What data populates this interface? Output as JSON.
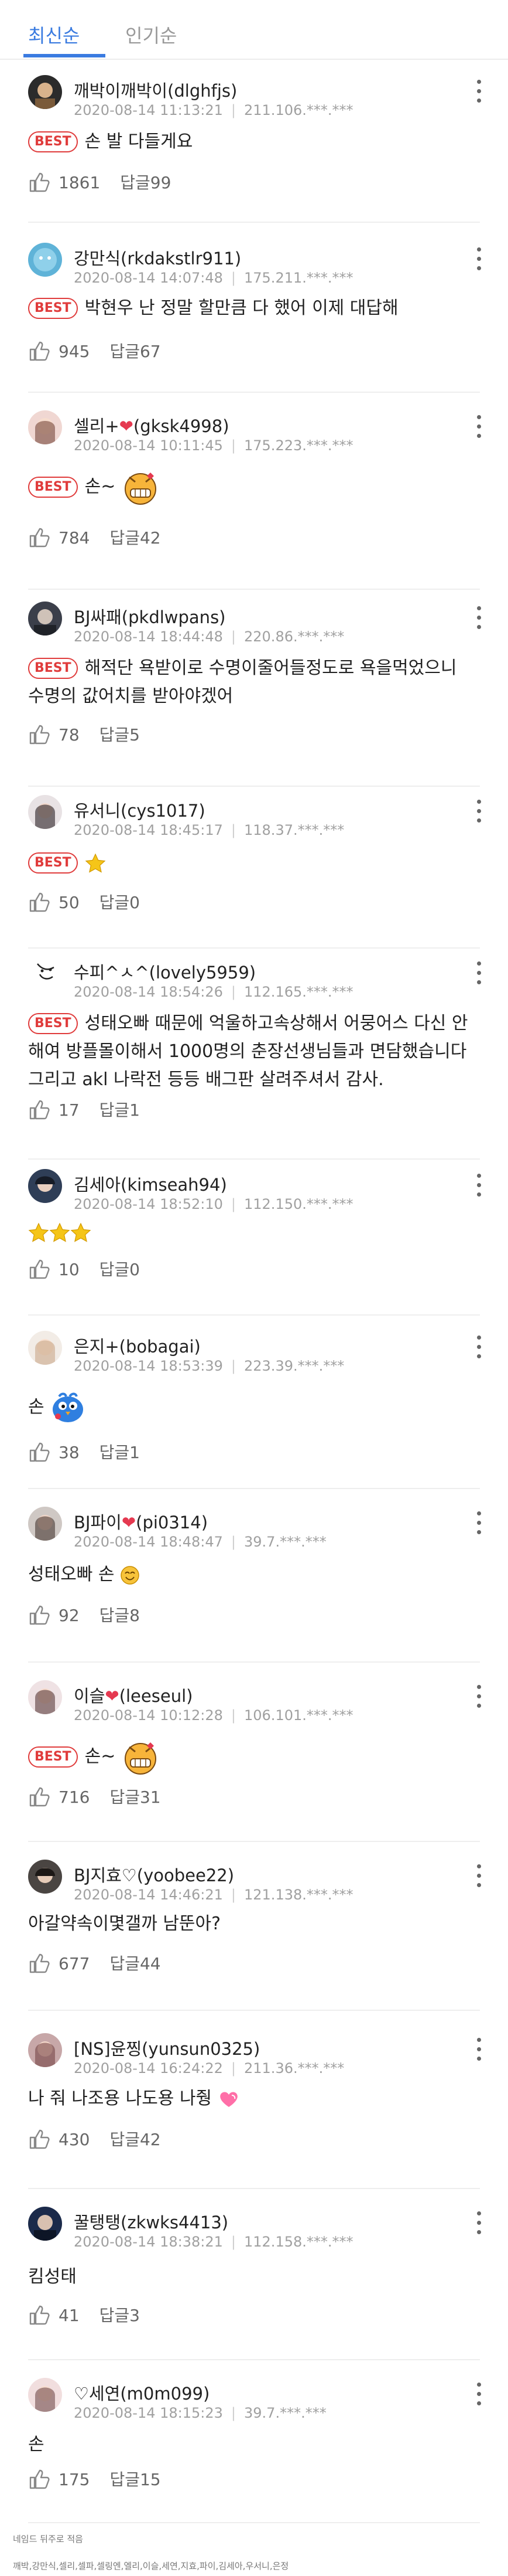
{
  "tabs": [
    {
      "label": "최신순"
    },
    {
      "label": "인기순"
    }
  ],
  "best_badge": "BEST",
  "colors": {
    "accent": "#3a7be0",
    "best": "#e03c3c",
    "heart": "#e53950"
  },
  "comments": [
    {
      "name": "깨박이깨박이(dlghfjs)",
      "date": "2020-08-14 11:13:21",
      "ip": "211.106.***.***",
      "best": true,
      "text": "손 발 다들게요",
      "likes": "1861",
      "replies": "답글99"
    },
    {
      "name": "강만식(rkdakstlr911)",
      "date": "2020-08-14 14:07:48",
      "ip": "175.211.***.***",
      "best": true,
      "text": "박현우 난 정말 할만큼 다 했어 이제 대답해",
      "likes": "945",
      "replies": "답글67"
    },
    {
      "name_pre": "셀리+",
      "name_post": "(gksk4998)",
      "date": "2020-08-14 10:11:45",
      "ip": "175.223.***.***",
      "best": true,
      "text": "손~",
      "likes": "784",
      "replies": "답글42"
    },
    {
      "name": "BJ싸패(pkdlwpans)",
      "date": "2020-08-14 18:44:48",
      "ip": "220.86.***.***",
      "best": true,
      "text": "해적단 욕받이로 수명이줄어들정도로 욕을먹었으니 수명의 값어치를 받아야겠어",
      "likes": "78",
      "replies": "답글5"
    },
    {
      "name": "유서니(cys1017)",
      "date": "2020-08-14 18:45:17",
      "ip": "118.37.***.***",
      "best": true,
      "text": "",
      "likes": "50",
      "replies": "답글0"
    },
    {
      "name": "수피^ㅅ^(lovely5959)",
      "date": "2020-08-14 18:54:26",
      "ip": "112.165.***.***",
      "best": true,
      "text": "성태오빠 때문에 억울하고속상해서 어뭉어스 다신 안해여 방플몰이해서 1000명의 춘장선생님들과 면담했습니다",
      "text2": "그리고 akl 나락전 등등 배그판 살려주셔서 감사.",
      "likes": "17",
      "replies": "답글1"
    },
    {
      "name": "김세아(kimseah94)",
      "date": "2020-08-14 18:52:10",
      "ip": "112.150.***.***",
      "best": false,
      "text": "",
      "likes": "10",
      "replies": "답글0"
    },
    {
      "name": "은지+(bobagai)",
      "date": "2020-08-14 18:53:39",
      "ip": "223.39.***.***",
      "best": false,
      "text": "손",
      "likes": "38",
      "replies": "답글1"
    },
    {
      "name_pre": "BJ파이",
      "name_post": "(pi0314)",
      "date": "2020-08-14 18:48:47",
      "ip": "39.7.***.***",
      "best": false,
      "text": "성태오빠 손",
      "likes": "92",
      "replies": "답글8"
    },
    {
      "name_pre": "이슬",
      "name_post": "(leeseul)",
      "date": "2020-08-14 10:12:28",
      "ip": "106.101.***.***",
      "best": true,
      "text": "손~",
      "likes": "716",
      "replies": "답글31"
    },
    {
      "name": "BJ지효♡(yoobee22)",
      "date": "2020-08-14 14:46:21",
      "ip": "121.138.***.***",
      "best": false,
      "text": "아갈약속이몇갤까 남뚠아?",
      "likes": "677",
      "replies": "답글44"
    },
    {
      "name": "[NS]윤찡(yunsun0325)",
      "date": "2020-08-14 16:24:22",
      "ip": "211.36.***.***",
      "best": false,
      "text": "나 줘 나조용 나도용 나줭",
      "likes": "430",
      "replies": "답글42"
    },
    {
      "name": "꿀탱탱(zkwks4413)",
      "date": "2020-08-14 18:38:21",
      "ip": "112.158.***.***",
      "best": false,
      "text": "킴성태",
      "likes": "41",
      "replies": "답글3"
    },
    {
      "name": "♡세연(m0m099)",
      "date": "2020-08-14 18:15:23",
      "ip": "39.7.***.***",
      "best": false,
      "text": "손",
      "likes": "175",
      "replies": "답글15"
    }
  ],
  "footer": {
    "line1": "네임드 뒤주로 적음",
    "line2": "깨박,강만식,셀리,셀파,셀링엔,엘리,이슬,세연,지효,파이,김세아,우서니,은정"
  }
}
